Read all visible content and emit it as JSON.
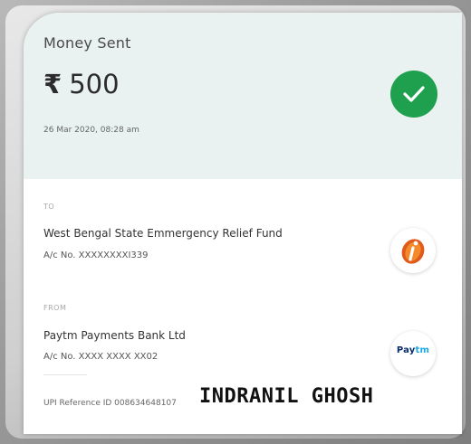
{
  "header": {
    "title": "Money Sent",
    "currency_symbol": "₹",
    "amount": "500",
    "datetime": "26 Mar 2020, 08:28 am",
    "status_color": "#1fa04f",
    "status_icon": "check-icon"
  },
  "to": {
    "label": "TO",
    "name": "West Bengal State Emmergency Relief Fund",
    "account": "A/c No. XXXXXXXXI339",
    "bank_icon": "icici-logo-icon",
    "bank_color": "#f26522"
  },
  "from": {
    "label": "FROM",
    "name": "Paytm Payments Bank Ltd",
    "account": "A/c No. XXXX XXXX XX02",
    "bank_logo_text_pay": "Pay",
    "bank_logo_text_tm": "tm"
  },
  "upi_reference": "UPI Reference ID 008634648107",
  "watermark": "INDRANIL GHOSH"
}
